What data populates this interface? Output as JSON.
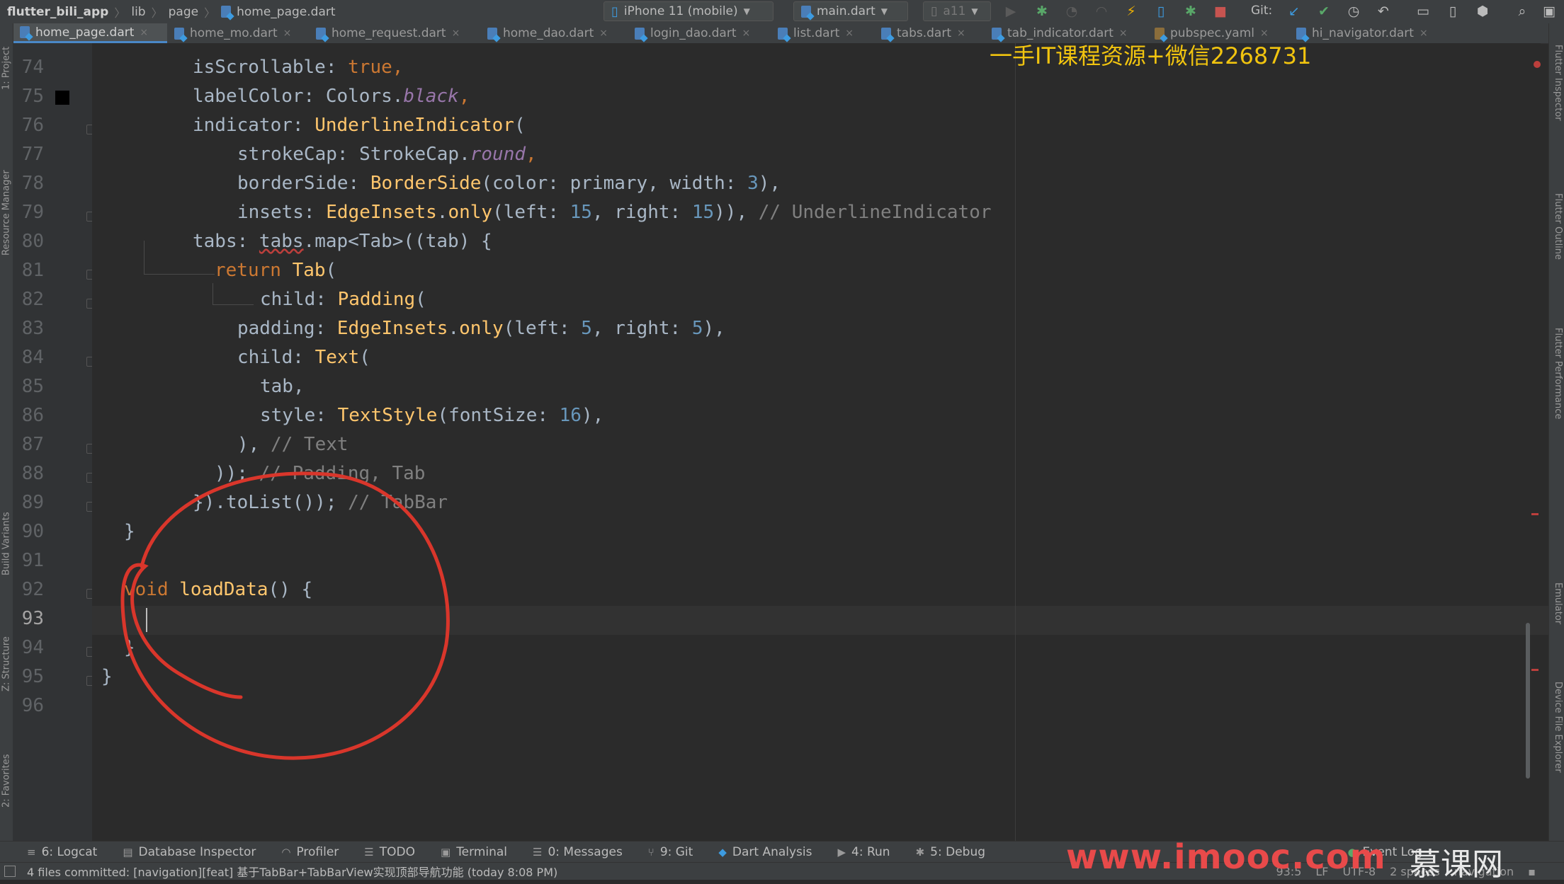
{
  "toolbar": {
    "project": "flutter_bili_app",
    "crumb_lib": "lib",
    "crumb_page": "page",
    "crumb_file": "home_page.dart",
    "device": "iPhone 11 (mobile)",
    "run_config": "main.dart",
    "flavor": "a11",
    "git_label": "Git:"
  },
  "tabs": [
    {
      "label": "home_page.dart"
    },
    {
      "label": "home_mo.dart"
    },
    {
      "label": "home_request.dart"
    },
    {
      "label": "home_dao.dart"
    },
    {
      "label": "login_dao.dart"
    },
    {
      "label": "list.dart"
    },
    {
      "label": "tabs.dart"
    },
    {
      "label": "tab_indicator.dart"
    },
    {
      "label": "pubspec.yaml"
    },
    {
      "label": "hi_navigator.dart"
    }
  ],
  "left_tools": [
    "1: Project",
    "Resource Manager",
    "Build Variants",
    "Z: Structure",
    "2: Favorites"
  ],
  "right_tools": [
    "Flutter Inspector",
    "Flutter Outline",
    "Flutter Performance",
    "Emulator",
    "Device File Explorer"
  ],
  "line_numbers": [
    "74",
    "75",
    "76",
    "77",
    "78",
    "79",
    "80",
    "81",
    "82",
    "83",
    "84",
    "85",
    "86",
    "87",
    "88",
    "89",
    "90",
    "91",
    "92",
    "93",
    "94",
    "95",
    "96"
  ],
  "code": {
    "l74": {
      "a": "isScrollable: ",
      "b": "true",
      "c": ","
    },
    "l75": {
      "a": "labelColor: Colors.",
      "b": "black",
      "c": ","
    },
    "l76": {
      "a": "indicator: ",
      "b": "UnderlineIndicator",
      "c": "("
    },
    "l77": {
      "a": "strokeCap: StrokeCap.",
      "b": "round",
      "c": ","
    },
    "l78": {
      "a": "borderSide: ",
      "b": "BorderSide",
      "c": "(color: primary, width: ",
      "d": "3",
      "e": "),"
    },
    "l79": {
      "a": "insets: ",
      "b": "EdgeInsets",
      "c": ".",
      "d": "only",
      "e": "(left: ",
      "f": "15",
      "g": ", right: ",
      "h": "15",
      "i": ")), ",
      "j": "// UnderlineIndicator"
    },
    "l80": {
      "a": "tabs: ",
      "b": "tabs",
      "c": ".map<Tab>((tab) {"
    },
    "l81": {
      "a": "return ",
      "b": "Tab",
      "c": "("
    },
    "l82": {
      "a": "child: ",
      "b": "Padding",
      "c": "("
    },
    "l83": {
      "a": "padding: ",
      "b": "EdgeInsets",
      "c": ".",
      "d": "only",
      "e": "(left: ",
      "f": "5",
      "g": ", right: ",
      "h": "5",
      "i": "),"
    },
    "l84": {
      "a": "child: ",
      "b": "Text",
      "c": "("
    },
    "l85": {
      "a": "tab,"
    },
    "l86": {
      "a": "style: ",
      "b": "TextStyle",
      "c": "(fontSize: ",
      "d": "16",
      "e": "),"
    },
    "l87": {
      "a": "), ",
      "b": "// Text"
    },
    "l88": {
      "a": ")); ",
      "b": "// Padding, Tab"
    },
    "l89": {
      "a": "}).toList()); ",
      "b": "// TabBar"
    },
    "l90": {
      "a": "}"
    },
    "l92": {
      "a": "void ",
      "b": "loadData",
      "c": "() {"
    },
    "l94": {
      "a": "}"
    },
    "l95": {
      "a": "}"
    }
  },
  "watermark_top": "一手IT课程资源+微信2268731",
  "watermark_bottom": "www.imooc.com",
  "watermark_logo": "慕课网",
  "bottom_tools": [
    {
      "label": "6: Logcat"
    },
    {
      "label": "Database Inspector"
    },
    {
      "label": "Profiler"
    },
    {
      "label": "TODO"
    },
    {
      "label": "Terminal"
    },
    {
      "label": "0: Messages"
    },
    {
      "label": "9: Git"
    },
    {
      "label": "Dart Analysis"
    },
    {
      "label": "4: Run"
    },
    {
      "label": "5: Debug"
    },
    {
      "label": "Event Log"
    }
  ],
  "status": {
    "message": "4 files committed: [navigation][feat] 基于TabBar+TabBarView实现顶部导航功能 (today 8:08 PM)",
    "position": "93:5",
    "line_sep": "LF",
    "encoding": "UTF-8",
    "indent": "2 spaces",
    "branch": "navigation"
  },
  "colors": {
    "annotation_circle": "#d9362b",
    "accent": "#4a88c7"
  }
}
